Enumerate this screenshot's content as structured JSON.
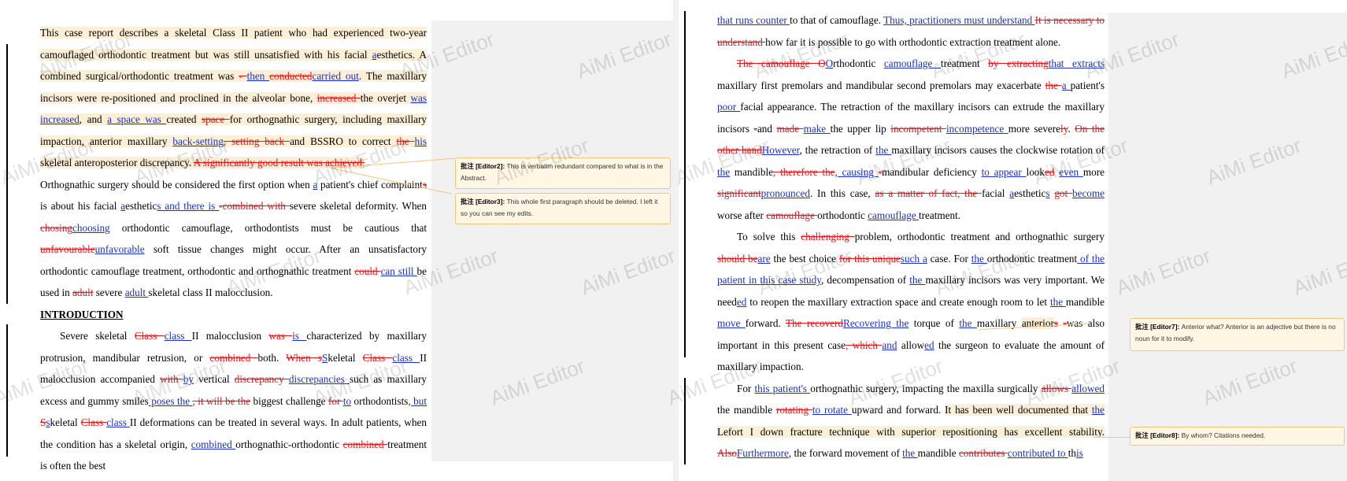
{
  "watermark": "AiMi Editor",
  "colors": {
    "deletion": "#e8161b",
    "insertion": "#1a2fc9",
    "highlight": "#fcefd8",
    "comment_border": "#f2c77b"
  },
  "comment_prefix": "批注",
  "left": {
    "p1": [
      [
        "h",
        "This case report describes a skeletal Class II patient who had experienced two-year camouflaged orthodontic treatment but was still unsatisfied with his facial "
      ],
      [
        "hi",
        "a"
      ],
      [
        "h",
        "esthetics. A combined surgical/orthodontic treatment was "
      ],
      [
        "hd",
        "- "
      ],
      [
        "hi",
        "then "
      ],
      [
        "hd",
        "conducted"
      ],
      [
        "hi",
        "carried out"
      ],
      [
        "h",
        ". The maxillary incisors were re-positioned and proclined in the alveolar bone, "
      ],
      [
        "hd",
        "increased "
      ],
      [
        "h",
        "the overjet "
      ],
      [
        "hi",
        "was increased"
      ],
      [
        "h",
        ", and "
      ],
      [
        "hi",
        "a space was "
      ],
      [
        "h",
        "created "
      ],
      [
        "hd",
        "space "
      ],
      [
        "h",
        "for orthognathic surgery, including maxillary impaction, anterior maxillary "
      ],
      [
        "hi",
        "back-setting"
      ],
      [
        "hd",
        ", setting back "
      ],
      [
        "h",
        "and BSSRO to correct "
      ],
      [
        "hd",
        "the "
      ],
      [
        "hi",
        "his"
      ],
      [
        "h",
        " skeletal anteroposterior discrepancy. "
      ],
      [
        "hd",
        "A significantly good result was achieved."
      ]
    ],
    "p2": [
      [
        "t",
        "Orthognathic surgery should be considered the first option when "
      ],
      [
        "i",
        "a"
      ],
      [
        "t",
        " patient's chief complaint"
      ],
      [
        "d",
        "s"
      ],
      [
        "t",
        " is about his facial "
      ],
      [
        "i",
        "a"
      ],
      [
        "t",
        "esthetic"
      ],
      [
        "i",
        "s and there is "
      ],
      [
        "d",
        " -combined with "
      ],
      [
        "t",
        "severe skeletal deformity. When "
      ],
      [
        "d",
        "chosing"
      ],
      [
        "i",
        "choosing"
      ],
      [
        "t",
        " orthodontic camouflage, orthodontists must be cautious that "
      ],
      [
        "d",
        "unfavourable"
      ],
      [
        "i",
        "unfavorable"
      ],
      [
        "t",
        " soft tissue changes might occur. After an unsatisfactory orthodontic camouflage treatment, orthodontic and orthognathic treatment "
      ],
      [
        "d",
        "could "
      ],
      [
        "i",
        "can still "
      ],
      [
        "t",
        "be used in "
      ],
      [
        "d",
        "adult"
      ],
      [
        "t",
        " severe "
      ],
      [
        "i",
        "adult "
      ],
      [
        "t",
        "skeletal class II malocclusion."
      ]
    ],
    "heading": "INTRODUCTION",
    "p3": [
      [
        "t",
        "Severe skeletal "
      ],
      [
        "d",
        "Class "
      ],
      [
        "i",
        "class "
      ],
      [
        "t",
        "II malocclusion "
      ],
      [
        "d",
        "was "
      ],
      [
        "i",
        "is "
      ],
      [
        "t",
        "characterized by maxillary protrusion, mandibular retrusion, or "
      ],
      [
        "d",
        "combined "
      ],
      [
        "t",
        "both. "
      ],
      [
        "d",
        "When s"
      ],
      [
        "i",
        "S"
      ],
      [
        "t",
        "keletal "
      ],
      [
        "d",
        "Class "
      ],
      [
        "i",
        " class "
      ],
      [
        "t",
        "II malocclusion accompanied "
      ],
      [
        "d",
        "with "
      ],
      [
        "i",
        "by"
      ],
      [
        "t",
        " vertical "
      ],
      [
        "d",
        "discrepancy "
      ],
      [
        "i",
        "discrepancies "
      ],
      [
        "t",
        "such as maxillary excess and gummy smiles"
      ],
      [
        "i",
        " poses the "
      ],
      [
        "d",
        ", it will be the"
      ],
      [
        "t",
        " biggest challenge "
      ],
      [
        "d",
        "for "
      ],
      [
        "i",
        "to"
      ],
      [
        "t",
        " orthodontists"
      ],
      [
        "i",
        ", but "
      ],
      [
        "d",
        "S"
      ],
      [
        "i",
        "s"
      ],
      [
        "t",
        "keletal "
      ],
      [
        "d",
        "Class "
      ],
      [
        "i",
        "class "
      ],
      [
        "t",
        "II deformations can be treated in several ways. In adult patients, when the condition has a skeletal origin, "
      ],
      [
        "i",
        "combined "
      ],
      [
        "t",
        "orthognathic-orthodontic "
      ],
      [
        "d",
        "combined "
      ],
      [
        "t",
        "treatment is often the best"
      ]
    ],
    "comments": [
      {
        "author": "[Editor2]:",
        "text": "This is verbatim redundant compared to what is in the Abstract."
      },
      {
        "author": "[Editor3]:",
        "text": "This whole first paragraph should be deleted.    I left it so you can see my edits."
      }
    ]
  },
  "right": {
    "p1": [
      [
        "i",
        "that runs counter "
      ],
      [
        "t",
        "to that of camouflage. "
      ],
      [
        "i",
        "Thus, practitioners must understand "
      ],
      [
        "d",
        "It is necessary to understand "
      ],
      [
        "t",
        "how far it is possible to go with orthodontic extraction treatment alone."
      ]
    ],
    "p2": [
      [
        "d",
        "The camouflage O"
      ],
      [
        "i",
        "O"
      ],
      [
        "t",
        "rthodontic "
      ],
      [
        "i",
        "camouflage "
      ],
      [
        "t",
        "treatment "
      ],
      [
        "d",
        "by extracting"
      ],
      [
        "i",
        "that extracts"
      ],
      [
        "t",
        " maxillary first premolars and mandibular second premolars may exacerbate "
      ],
      [
        "d",
        "the "
      ],
      [
        "i",
        "a "
      ],
      [
        "t",
        "patient's "
      ],
      [
        "i",
        "poor "
      ],
      [
        "t",
        "facial appearance. The retraction of the maxillary incisors can extrude the maxillary incisors "
      ],
      [
        "d",
        "-"
      ],
      [
        "t",
        "and "
      ],
      [
        "d",
        "made "
      ],
      [
        "i",
        "make "
      ],
      [
        "t",
        "the upper lip "
      ],
      [
        "d",
        "incompetent "
      ],
      [
        "i",
        "incompetence "
      ],
      [
        "t",
        "more severe"
      ],
      [
        "d",
        "ly"
      ],
      [
        "t",
        ". "
      ],
      [
        "d",
        "On the other hand"
      ],
      [
        "i",
        "However"
      ],
      [
        "t",
        ", the retraction of "
      ],
      [
        "i",
        "the "
      ],
      [
        "t",
        "maxillary incisors causes the clockwise rotation of "
      ],
      [
        "i",
        "the"
      ],
      [
        "t",
        " mandible"
      ],
      [
        "d",
        ", therefore the"
      ],
      [
        "i",
        ", causing "
      ],
      [
        "d",
        "-"
      ],
      [
        "t",
        "mandibular deficiency "
      ],
      [
        "i",
        "to appear "
      ],
      [
        "t",
        "look"
      ],
      [
        "d",
        "ed"
      ],
      [
        "t",
        " "
      ],
      [
        "i",
        "even "
      ],
      [
        "t",
        "more "
      ],
      [
        "d",
        "significant"
      ],
      [
        "i",
        "pronounced"
      ],
      [
        "t",
        ". In this case, "
      ],
      [
        "d",
        "as a matter of fact, the "
      ],
      [
        "t",
        "facial "
      ],
      [
        "i",
        "a"
      ],
      [
        "t",
        "esthetic"
      ],
      [
        "i",
        "s"
      ],
      [
        "t",
        " "
      ],
      [
        "d",
        "got "
      ],
      [
        "i",
        "become "
      ],
      [
        "t",
        "worse after "
      ],
      [
        "d",
        "camouflage "
      ],
      [
        "t",
        "orthodontic "
      ],
      [
        "i",
        "camouflage "
      ],
      [
        "t",
        "treatment."
      ]
    ],
    "p3": [
      [
        "t",
        "To solve this "
      ],
      [
        "d",
        "challenging "
      ],
      [
        "t",
        "problem, orthodontic treatment and orthognathic surgery "
      ],
      [
        "d",
        "should be"
      ],
      [
        "i",
        "are"
      ],
      [
        "t",
        " the best choice "
      ],
      [
        "d",
        "for this unique"
      ],
      [
        "i",
        "such a"
      ],
      [
        "t",
        " case. For "
      ],
      [
        "i",
        "the "
      ],
      [
        "t",
        "orthodontic treatment"
      ],
      [
        "i",
        " of the patient in this case study"
      ],
      [
        "t",
        ", decompensation of "
      ],
      [
        "i",
        "the "
      ],
      [
        "t",
        "maxillary incisors was very important. We need"
      ],
      [
        "i",
        "ed"
      ],
      [
        "t",
        " to reopen the maxillary extraction space and create enough room to let "
      ],
      [
        "i",
        "the "
      ],
      [
        "t",
        "mandible "
      ],
      [
        "i",
        "move "
      ],
      [
        "t",
        "forward. "
      ],
      [
        "d",
        "The recoverd"
      ],
      [
        "i",
        "Recovering the"
      ],
      [
        "t",
        " torque of "
      ],
      [
        "i",
        "the "
      ],
      [
        "t",
        "maxillary "
      ],
      [
        "h",
        "anterior"
      ],
      [
        "d",
        "s"
      ],
      [
        "t",
        " "
      ],
      [
        "d",
        "-"
      ],
      [
        "t",
        "was also important in this present case"
      ],
      [
        "d",
        ", which "
      ],
      [
        "i",
        " and"
      ],
      [
        "t",
        " allow"
      ],
      [
        "i",
        "ed"
      ],
      [
        "t",
        " the surgeon to evaluate the amount of maxillary impaction."
      ]
    ],
    "p4": [
      [
        "t",
        "For "
      ],
      [
        "i",
        "this patient's "
      ],
      [
        "t",
        "orthognathic surgery, impacting the maxilla surgically "
      ],
      [
        "d",
        "allows "
      ],
      [
        "i",
        "allowed"
      ],
      [
        "t",
        " the mandible "
      ],
      [
        "d",
        "rotating "
      ],
      [
        "i",
        "to rotate "
      ],
      [
        "t",
        "upward and forward. "
      ],
      [
        "h",
        "It has been well documented that "
      ],
      [
        "hi",
        "the"
      ],
      [
        "h",
        " Lefort I down fracture technique with superior repositioning has excellent stability."
      ],
      [
        "t",
        " "
      ],
      [
        "d",
        "Also"
      ],
      [
        "i",
        "Furthermore"
      ],
      [
        "t",
        ", the forward movement of "
      ],
      [
        "i",
        "the "
      ],
      [
        "t",
        "mandible "
      ],
      [
        "d",
        "contributes "
      ],
      [
        "i",
        "contributed to "
      ],
      [
        "t",
        "th"
      ],
      [
        "i",
        "is"
      ]
    ],
    "comments": [
      {
        "author": "[Editor7]:",
        "text": "Anterior what?    Anterior is an adjective but there is no noun for it to modify."
      },
      {
        "author": "[Editor8]:",
        "text": "By whom?    Citations needed."
      }
    ]
  }
}
